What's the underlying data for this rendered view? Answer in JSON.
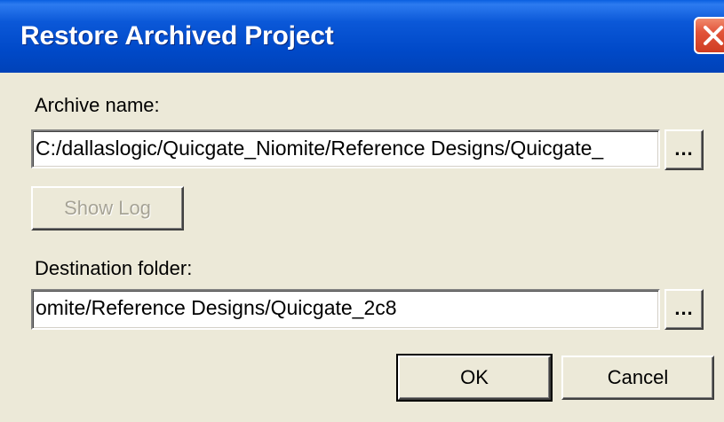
{
  "window": {
    "title": "Restore Archived Project",
    "close_icon": "close-icon"
  },
  "archive": {
    "label": "Archive name:",
    "value": "C:/dallaslogic/Quicgate_Niomite/Reference Designs/Quicgate_",
    "browse_label": "..."
  },
  "show_log": {
    "label": "Show Log",
    "enabled": false
  },
  "destination": {
    "label": "Destination folder:",
    "value": "omite/Reference Designs/Quicgate_2c8",
    "browse_label": "..."
  },
  "actions": {
    "ok_label": "OK",
    "cancel_label": "Cancel"
  },
  "colors": {
    "titlebar": "#0049c8",
    "dialog_bg": "#ece9d8",
    "close_button": "#e2543a"
  }
}
